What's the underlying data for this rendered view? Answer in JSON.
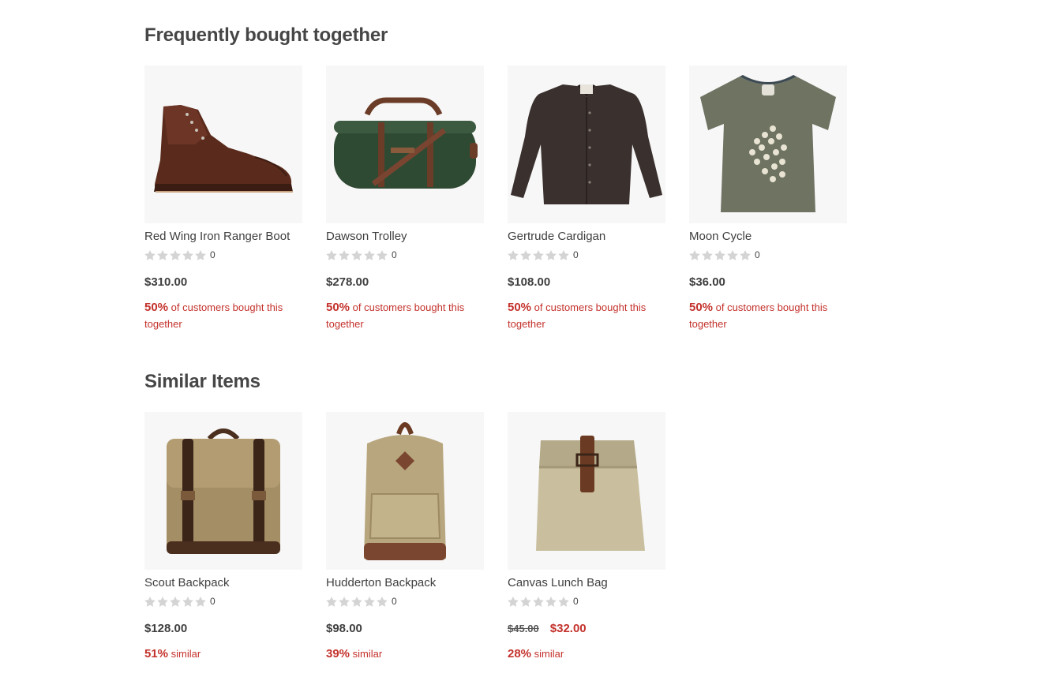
{
  "sections": [
    {
      "title": "Frequently bought together",
      "products": [
        {
          "name": "Red Wing Iron Ranger Boot",
          "rating_count": "0",
          "price": "$310.00",
          "stat_pct": "50%",
          "stat_text": "of customers bought this together",
          "image_icon": "boot-image"
        },
        {
          "name": "Dawson Trolley",
          "rating_count": "0",
          "price": "$278.00",
          "stat_pct": "50%",
          "stat_text": "of customers bought this together",
          "image_icon": "duffel-bag-image"
        },
        {
          "name": "Gertrude Cardigan",
          "rating_count": "0",
          "price": "$108.00",
          "stat_pct": "50%",
          "stat_text": "of customers bought this together",
          "image_icon": "cardigan-image"
        },
        {
          "name": "Moon Cycle",
          "rating_count": "0",
          "price": "$36.00",
          "stat_pct": "50%",
          "stat_text": "of customers bought this together",
          "image_icon": "tshirt-image"
        }
      ]
    },
    {
      "title": "Similar Items",
      "products": [
        {
          "name": "Scout Backpack",
          "rating_count": "0",
          "price": "$128.00",
          "stat_pct": "51%",
          "stat_text": "similar",
          "image_icon": "backpack-image"
        },
        {
          "name": "Hudderton Backpack",
          "rating_count": "0",
          "price": "$98.00",
          "stat_pct": "39%",
          "stat_text": "similar",
          "image_icon": "backpack-image"
        },
        {
          "name": "Canvas Lunch Bag",
          "rating_count": "0",
          "old_price": "$45.00",
          "sale_price": "$32.00",
          "stat_pct": "28%",
          "stat_text": "similar",
          "image_icon": "lunch-bag-image"
        }
      ]
    }
  ],
  "colors": {
    "accent": "#c4322c",
    "text": "#3f3f3f",
    "star": "#d4d4d4",
    "image_bg": "#f7f7f7"
  }
}
